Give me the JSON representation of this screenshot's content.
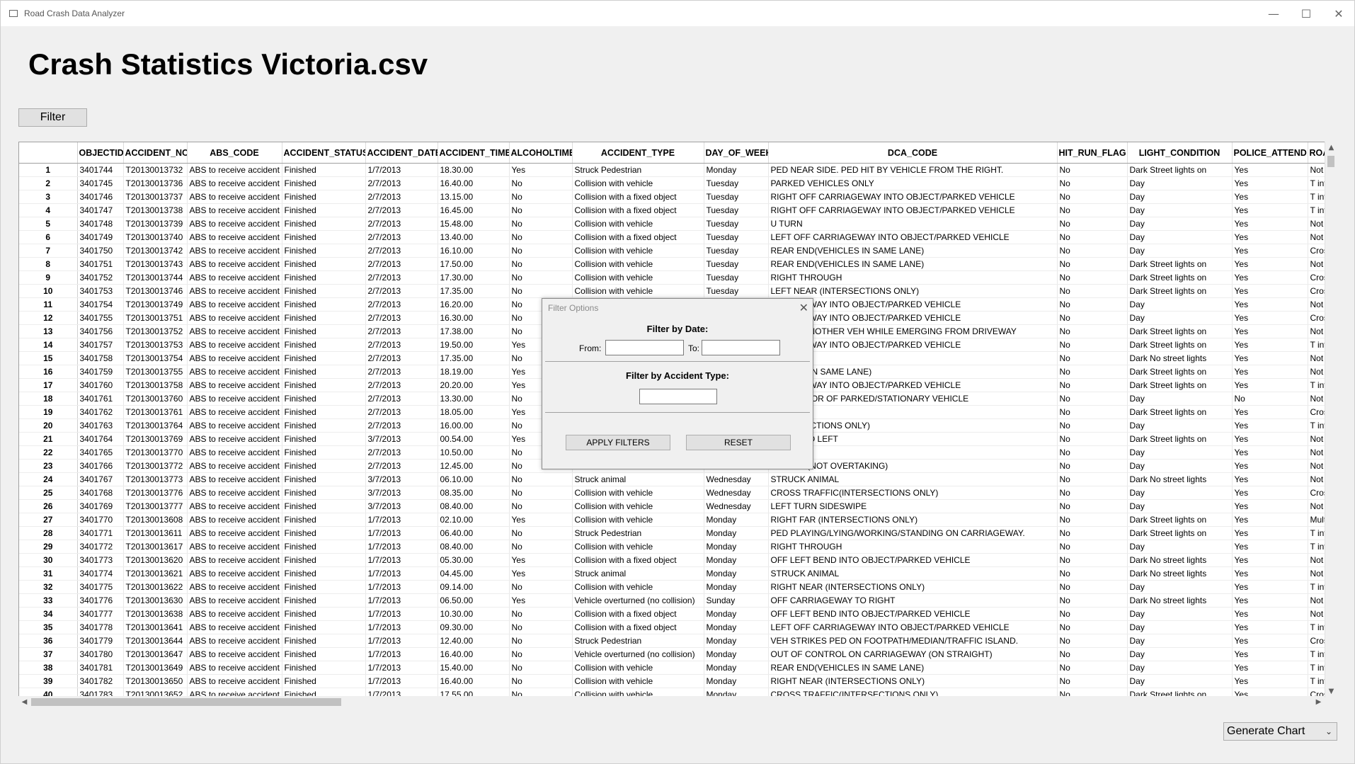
{
  "window": {
    "title": "Road Crash Data Analyzer"
  },
  "page_title": "Crash Statistics Victoria.csv",
  "toolbar": {
    "filter_label": "Filter"
  },
  "table": {
    "columns": [
      "OBJECTID",
      "ACCIDENT_NO",
      "ABS_CODE",
      "ACCIDENT_STATUS",
      "ACCIDENT_DATE",
      "ACCIDENT_TIME",
      "ALCOHOLTIME",
      "ACCIDENT_TYPE",
      "DAY_OF_WEEK",
      "DCA_CODE",
      "HIT_RUN_FLAG",
      "LIGHT_CONDITION",
      "POLICE_ATTEND",
      "ROAI"
    ],
    "rows": [
      [
        "1",
        "3401744",
        "T20130013732",
        "ABS to receive accident",
        "Finished",
        "1/7/2013",
        "18.30.00",
        "Yes",
        "Struck Pedestrian",
        "Monday",
        "PED NEAR SIDE. PED HIT BY VEHICLE FROM THE RIGHT.",
        "No",
        "Dark Street lights on",
        "Yes",
        "Not at"
      ],
      [
        "2",
        "3401745",
        "T20130013736",
        "ABS to receive accident",
        "Finished",
        "2/7/2013",
        "16.40.00",
        "No",
        "Collision with vehicle",
        "Tuesday",
        "PARKED VEHICLES ONLY",
        "No",
        "Day",
        "Yes",
        "T inter"
      ],
      [
        "3",
        "3401746",
        "T20130013737",
        "ABS to receive accident",
        "Finished",
        "2/7/2013",
        "13.15.00",
        "No",
        "Collision with a fixed object",
        "Tuesday",
        "RIGHT OFF CARRIAGEWAY INTO OBJECT/PARKED VEHICLE",
        "No",
        "Day",
        "Yes",
        "T inter"
      ],
      [
        "4",
        "3401747",
        "T20130013738",
        "ABS to receive accident",
        "Finished",
        "2/7/2013",
        "16.45.00",
        "No",
        "Collision with a fixed object",
        "Tuesday",
        "RIGHT OFF CARRIAGEWAY INTO OBJECT/PARKED VEHICLE",
        "No",
        "Day",
        "Yes",
        "T inter"
      ],
      [
        "5",
        "3401748",
        "T20130013739",
        "ABS to receive accident",
        "Finished",
        "2/7/2013",
        "15.48.00",
        "No",
        "Collision with vehicle",
        "Tuesday",
        "U TURN",
        "No",
        "Day",
        "Yes",
        "Not at"
      ],
      [
        "6",
        "3401749",
        "T20130013740",
        "ABS to receive accident",
        "Finished",
        "2/7/2013",
        "13.40.00",
        "No",
        "Collision with a fixed object",
        "Tuesday",
        "LEFT OFF CARRIAGEWAY INTO OBJECT/PARKED VEHICLE",
        "No",
        "Day",
        "Yes",
        "Not at"
      ],
      [
        "7",
        "3401750",
        "T20130013742",
        "ABS to receive accident",
        "Finished",
        "2/7/2013",
        "16.10.00",
        "No",
        "Collision with vehicle",
        "Tuesday",
        "REAR END(VEHICLES IN SAME LANE)",
        "No",
        "Day",
        "Yes",
        "Cross"
      ],
      [
        "8",
        "3401751",
        "T20130013743",
        "ABS to receive accident",
        "Finished",
        "2/7/2013",
        "17.50.00",
        "No",
        "Collision with vehicle",
        "Tuesday",
        "REAR END(VEHICLES IN SAME LANE)",
        "No",
        "Dark Street lights on",
        "Yes",
        "Not at"
      ],
      [
        "9",
        "3401752",
        "T20130013744",
        "ABS to receive accident",
        "Finished",
        "2/7/2013",
        "17.30.00",
        "No",
        "Collision with vehicle",
        "Tuesday",
        "RIGHT THROUGH",
        "No",
        "Dark Street lights on",
        "Yes",
        "Cross"
      ],
      [
        "10",
        "3401753",
        "T20130013746",
        "ABS to receive accident",
        "Finished",
        "2/7/2013",
        "17.35.00",
        "No",
        "Collision with vehicle",
        "Tuesday",
        "LEFT NEAR (INTERSECTIONS ONLY)",
        "No",
        "Dark Street lights on",
        "Yes",
        "Cross"
      ],
      [
        "11",
        "3401754",
        "T20130013749",
        "ABS to receive accident",
        "Finished",
        "2/7/2013",
        "16.20.00",
        "No",
        "",
        "",
        "ARRIAGEWAY INTO OBJECT/PARKED VEHICLE",
        "No",
        "Day",
        "Yes",
        "Not at"
      ],
      [
        "12",
        "3401755",
        "T20130013751",
        "ABS to receive accident",
        "Finished",
        "2/7/2013",
        "16.30.00",
        "No",
        "",
        "",
        "ARRIAGEWAY INTO OBJECT/PARKED VEHICLE",
        "No",
        "Day",
        "Yes",
        "Cross"
      ],
      [
        "13",
        "3401756",
        "T20130013752",
        "ABS to receive accident",
        "Finished",
        "2/7/2013",
        "17.38.00",
        "No",
        "",
        "",
        "TRIKES ANOTHER VEH WHILE EMERGING FROM DRIVEWAY",
        "No",
        "Dark Street lights on",
        "Yes",
        "Not at"
      ],
      [
        "14",
        "3401757",
        "T20130013753",
        "ABS to receive accident",
        "Finished",
        "2/7/2013",
        "19.50.00",
        "Yes",
        "",
        "",
        "ARRIAGEWAY INTO OBJECT/PARKED VEHICLE",
        "No",
        "Dark Street lights on",
        "Yes",
        "T inter"
      ],
      [
        "15",
        "3401758",
        "T20130013754",
        "ABS to receive accident",
        "Finished",
        "2/7/2013",
        "17.35.00",
        "No",
        "",
        "",
        "",
        "No",
        "Dark No street lights",
        "Yes",
        "Not at"
      ],
      [
        "16",
        "3401759",
        "T20130013755",
        "ABS to receive accident",
        "Finished",
        "2/7/2013",
        "18.19.00",
        "Yes",
        "",
        "",
        "EHICLES IN SAME LANE)",
        "No",
        "Dark Street lights on",
        "Yes",
        "Not at"
      ],
      [
        "17",
        "3401760",
        "T20130013758",
        "ABS to receive accident",
        "Finished",
        "2/7/2013",
        "20.20.00",
        "Yes",
        "",
        "",
        "ARRIAGEWAY INTO OBJECT/PARKED VEHICLE",
        "No",
        "Dark Street lights on",
        "Yes",
        "T inter"
      ],
      [
        "18",
        "3401761",
        "T20130013760",
        "ABS to receive accident",
        "Finished",
        "2/7/2013",
        "13.30.00",
        "No",
        "",
        "",
        "RIKES DOOR OF PARKED/STATIONARY VEHICLE",
        "No",
        "Day",
        "No",
        "Not at"
      ],
      [
        "19",
        "3401762",
        "T20130013761",
        "ABS to receive accident",
        "Finished",
        "2/7/2013",
        "18.05.00",
        "Yes",
        "",
        "",
        "UGH",
        "No",
        "Dark Street lights on",
        "Yes",
        "Cross"
      ],
      [
        "20",
        "3401763",
        "T20130013764",
        "ABS to receive accident",
        "Finished",
        "2/7/2013",
        "16.00.00",
        "No",
        "",
        "",
        "(INTERSECTIONS ONLY)",
        "No",
        "Day",
        "Yes",
        "T inter"
      ],
      [
        "21",
        "3401764",
        "T20130013769",
        "ABS to receive accident",
        "Finished",
        "3/7/2013",
        "00.54.00",
        "Yes",
        "",
        "",
        "GEWAY TO LEFT",
        "No",
        "Dark Street lights on",
        "Yes",
        "Not at"
      ],
      [
        "22",
        "3401765",
        "T20130013770",
        "ABS to receive accident",
        "Finished",
        "2/7/2013",
        "10.50.00",
        "No",
        "",
        "",
        "",
        "No",
        "Day",
        "Yes",
        "Not at"
      ],
      [
        "23",
        "3401766",
        "T20130013772",
        "ABS to receive accident",
        "Finished",
        "2/7/2013",
        "12.45.00",
        "No",
        "",
        "",
        "E RIGHT (NOT OVERTAKING)",
        "No",
        "Day",
        "Yes",
        "Not at"
      ],
      [
        "24",
        "3401767",
        "T20130013773",
        "ABS to receive accident",
        "Finished",
        "3/7/2013",
        "06.10.00",
        "No",
        "Struck animal",
        "Wednesday",
        "STRUCK ANIMAL",
        "No",
        "Dark No street lights",
        "Yes",
        "Not at"
      ],
      [
        "25",
        "3401768",
        "T20130013776",
        "ABS to receive accident",
        "Finished",
        "3/7/2013",
        "08.35.00",
        "No",
        "Collision with vehicle",
        "Wednesday",
        "CROSS TRAFFIC(INTERSECTIONS ONLY)",
        "No",
        "Day",
        "Yes",
        "Cross"
      ],
      [
        "26",
        "3401769",
        "T20130013777",
        "ABS to receive accident",
        "Finished",
        "3/7/2013",
        "08.40.00",
        "No",
        "Collision with vehicle",
        "Wednesday",
        "LEFT TURN SIDESWIPE",
        "No",
        "Day",
        "Yes",
        "Not at"
      ],
      [
        "27",
        "3401770",
        "T20130013608",
        "ABS to receive accident",
        "Finished",
        "1/7/2013",
        "02.10.00",
        "Yes",
        "Collision with vehicle",
        "Monday",
        "RIGHT FAR (INTERSECTIONS ONLY)",
        "No",
        "Dark Street lights on",
        "Yes",
        "Multip"
      ],
      [
        "28",
        "3401771",
        "T20130013611",
        "ABS to receive accident",
        "Finished",
        "1/7/2013",
        "06.40.00",
        "No",
        "Struck Pedestrian",
        "Monday",
        "PED PLAYING/LYING/WORKING/STANDING ON CARRIAGEWAY.",
        "No",
        "Dark Street lights on",
        "Yes",
        "T inter"
      ],
      [
        "29",
        "3401772",
        "T20130013617",
        "ABS to receive accident",
        "Finished",
        "1/7/2013",
        "08.40.00",
        "No",
        "Collision with vehicle",
        "Monday",
        "RIGHT THROUGH",
        "No",
        "Day",
        "Yes",
        "T inter"
      ],
      [
        "30",
        "3401773",
        "T20130013620",
        "ABS to receive accident",
        "Finished",
        "1/7/2013",
        "05.30.00",
        "Yes",
        "Collision with a fixed object",
        "Monday",
        "OFF LEFT BEND INTO OBJECT/PARKED VEHICLE",
        "No",
        "Dark No street lights",
        "Yes",
        "Not at"
      ],
      [
        "31",
        "3401774",
        "T20130013621",
        "ABS to receive accident",
        "Finished",
        "1/7/2013",
        "04.45.00",
        "Yes",
        "Struck animal",
        "Monday",
        "STRUCK ANIMAL",
        "No",
        "Dark No street lights",
        "Yes",
        "Not at"
      ],
      [
        "32",
        "3401775",
        "T20130013622",
        "ABS to receive accident",
        "Finished",
        "1/7/2013",
        "09.14.00",
        "No",
        "Collision with vehicle",
        "Monday",
        "RIGHT NEAR (INTERSECTIONS ONLY)",
        "No",
        "Day",
        "Yes",
        "T inter"
      ],
      [
        "33",
        "3401776",
        "T20130013630",
        "ABS to receive accident",
        "Finished",
        "1/7/2013",
        "06.50.00",
        "Yes",
        "Vehicle overturned (no collision)",
        "Sunday",
        "OFF CARRIAGEWAY TO RIGHT",
        "No",
        "Dark No street lights",
        "Yes",
        "Not at"
      ],
      [
        "34",
        "3401777",
        "T20130013638",
        "ABS to receive accident",
        "Finished",
        "1/7/2013",
        "10.30.00",
        "No",
        "Collision with a fixed object",
        "Monday",
        "OFF LEFT BEND INTO OBJECT/PARKED VEHICLE",
        "No",
        "Day",
        "Yes",
        "Not at"
      ],
      [
        "35",
        "3401778",
        "T20130013641",
        "ABS to receive accident",
        "Finished",
        "1/7/2013",
        "09.30.00",
        "No",
        "Collision with a fixed object",
        "Monday",
        "LEFT OFF CARRIAGEWAY INTO OBJECT/PARKED VEHICLE",
        "No",
        "Day",
        "Yes",
        "T inter"
      ],
      [
        "36",
        "3401779",
        "T20130013644",
        "ABS to receive accident",
        "Finished",
        "1/7/2013",
        "12.40.00",
        "No",
        "Struck Pedestrian",
        "Monday",
        "VEH STRIKES PED ON FOOTPATH/MEDIAN/TRAFFIC ISLAND.",
        "No",
        "Day",
        "Yes",
        "Cross"
      ],
      [
        "37",
        "3401780",
        "T20130013647",
        "ABS to receive accident",
        "Finished",
        "1/7/2013",
        "16.40.00",
        "No",
        "Vehicle overturned (no collision)",
        "Monday",
        "OUT OF CONTROL ON CARRIAGEWAY (ON STRAIGHT)",
        "No",
        "Day",
        "Yes",
        "T inter"
      ],
      [
        "38",
        "3401781",
        "T20130013649",
        "ABS to receive accident",
        "Finished",
        "1/7/2013",
        "15.40.00",
        "No",
        "Collision with vehicle",
        "Monday",
        "REAR END(VEHICLES IN SAME LANE)",
        "No",
        "Day",
        "Yes",
        "T inter"
      ],
      [
        "39",
        "3401782",
        "T20130013650",
        "ABS to receive accident",
        "Finished",
        "1/7/2013",
        "16.40.00",
        "No",
        "Collision with vehicle",
        "Monday",
        "RIGHT NEAR (INTERSECTIONS ONLY)",
        "No",
        "Day",
        "Yes",
        "T inter"
      ],
      [
        "40",
        "3401783",
        "T20130013652",
        "ABS to receive accident",
        "Finished",
        "1/7/2013",
        "17.55.00",
        "No",
        "Collision with vehicle",
        "Monday",
        "CROSS TRAFFIC(INTERSECTIONS ONLY)",
        "No",
        "Dark Street lights on",
        "Yes",
        "Cross"
      ]
    ]
  },
  "filter_dialog": {
    "title": "Filter Options",
    "date_section": "Filter by Date:",
    "from_label": "From:",
    "to_label": "To:",
    "type_section": "Filter by Accident Type:",
    "apply_label": "APPLY FILTERS",
    "reset_label": "RESET"
  },
  "chart_select": {
    "selected": "Generate Chart"
  },
  "icons": {
    "minimize": "minimize-icon",
    "maximize": "maximize-icon",
    "close": "close-icon",
    "scroll_up": "scroll-up-icon",
    "scroll_down": "scroll-down-icon",
    "scroll_left": "scroll-left-icon",
    "scroll_right": "scroll-right-icon",
    "chevron": "chevron-down-icon"
  }
}
